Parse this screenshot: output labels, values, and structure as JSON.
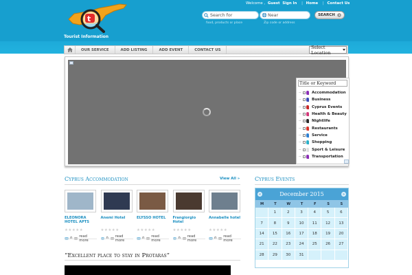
{
  "header": {
    "tagline": "Tourist Information",
    "welcome": "Welcome ,",
    "user": "Guest",
    "sign_in": "Sign In",
    "home": "Home",
    "contact": "Contact Us"
  },
  "search": {
    "what_placeholder": "Search for",
    "what_hint": "food, products or place",
    "near_placeholder": "Near",
    "near_hint": "Zip code or address",
    "button": "SEARCH"
  },
  "nav": {
    "items": [
      "OUR SERVICE",
      "ADD LISTING",
      "ADD EVENT",
      "CONTACT US"
    ],
    "location_select": "Select Location"
  },
  "map": {
    "keyword_placeholder": "Title or Keyword",
    "categories": [
      {
        "label": "Accommodation",
        "color": "#8b2fb5"
      },
      {
        "label": "Business",
        "color": "#3b4db8"
      },
      {
        "label": "Cyprus Events",
        "color": "#c62a2a"
      },
      {
        "label": "Health & Beauty",
        "color": "#d23a7a"
      },
      {
        "label": "Nightlife",
        "color": "#2b2b2b"
      },
      {
        "label": "Restaurants",
        "color": "#d9342b"
      },
      {
        "label": "Service",
        "color": "#2f7fd1"
      },
      {
        "label": "Shopping",
        "color": "#2bb0c9"
      },
      {
        "label": "Sport & Leisure",
        "color": "#e0e0e0"
      },
      {
        "label": "Transportation",
        "color": "#8b2fb5"
      }
    ]
  },
  "accommodation": {
    "title": "Cyprus Accommodation",
    "view_all": "View All »",
    "items": [
      {
        "name": "ELEONORA HOTEL APTS",
        "comments": "0",
        "more": "read more",
        "thumb_color": "#9fb6c9"
      },
      {
        "name": "Anemi Hotel",
        "comments": "0",
        "more": "read more",
        "thumb_color": "#2f3a52"
      },
      {
        "name": "ELYSSO HOTEL",
        "comments": "0",
        "more": "read more",
        "thumb_color": "#7a5a44"
      },
      {
        "name": "Frangiorgio Hotel",
        "comments": "0",
        "more": "read more",
        "thumb_color": "#4a3a30"
      },
      {
        "name": "Annabelle hotel",
        "comments": "0",
        "more": "read more",
        "thumb_color": "#6e7f8e"
      }
    ]
  },
  "events": {
    "title": "Cyprus Events",
    "calendar": {
      "month": "December 2015",
      "prev": "«",
      "next": "»",
      "days_of_week": [
        "M",
        "T",
        "W",
        "T",
        "F",
        "S",
        "S"
      ],
      "cells": [
        "",
        "1",
        "2",
        "3",
        "4",
        "5",
        "6",
        "7",
        "8",
        "9",
        "10",
        "11",
        "12",
        "13",
        "14",
        "15",
        "16",
        "17",
        "18",
        "19",
        "20",
        "21",
        "22",
        "23",
        "24",
        "25",
        "26",
        "27",
        "28",
        "29",
        "30",
        "31",
        "",
        "",
        ""
      ]
    }
  },
  "review": {
    "title": "“Excellent place to stay in Protaras”"
  }
}
